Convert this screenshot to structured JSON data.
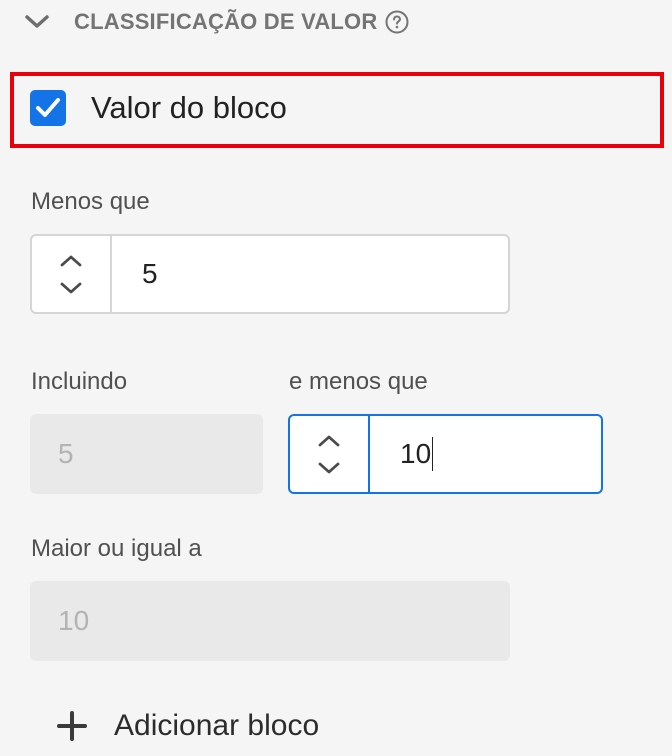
{
  "section": {
    "title": "CLASSIFICAÇÃO DE VALOR",
    "expanded": true,
    "chevron_icon": "chevron-down-icon",
    "help_icon": "help-circle-icon"
  },
  "block_value": {
    "label": "Valor do bloco",
    "checked": true
  },
  "less_than": {
    "label": "Menos que",
    "value": "5"
  },
  "including": {
    "label": "Incluindo",
    "value": "5"
  },
  "and_less_than": {
    "label": "e menos que",
    "value": "10"
  },
  "greater_or_equal": {
    "label": "Maior ou igual a",
    "value": "10"
  },
  "add_block": {
    "label": "Adicionar bloco",
    "icon": "plus-icon"
  },
  "colors": {
    "accent": "#1473e6",
    "highlight": "#e8000b",
    "background": "#f5f5f5"
  }
}
